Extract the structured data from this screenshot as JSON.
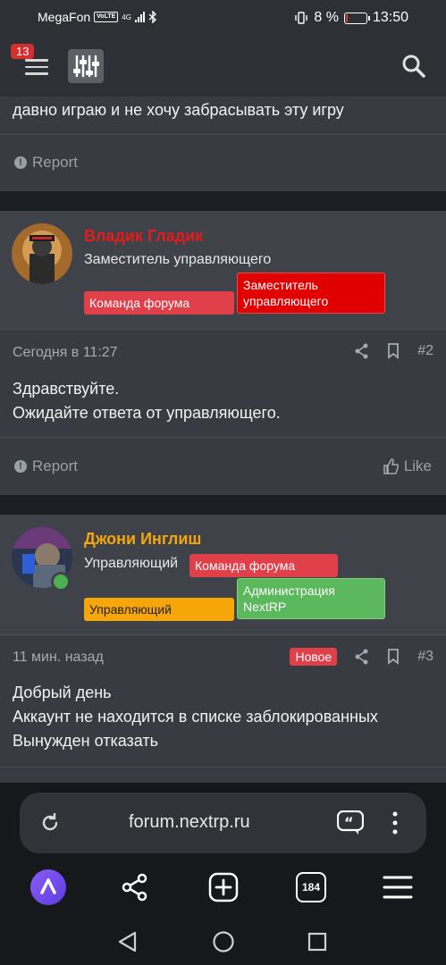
{
  "status_bar": {
    "carrier": "MegaFon",
    "volte": "VoLTE",
    "network": "4G",
    "battery": "8 %",
    "battery_level": 0.08,
    "time": "13:50"
  },
  "header": {
    "notification_count": "13",
    "icons": [
      "menu-icon",
      "settings-sliders-icon",
      "search-icon"
    ]
  },
  "post1": {
    "text": "давно играю и не хочу забрасывать эту игру",
    "report_label": "Report"
  },
  "post2": {
    "author": "Владик Гладик",
    "author_color": "#e51b1b",
    "user_title": "Заместитель управляющего",
    "banners": [
      {
        "label": "Команда форума",
        "color": "#e0404a"
      },
      {
        "label": "Заместитель управляющего",
        "color": "#e00000"
      }
    ],
    "time": "Сегодня в 11:27",
    "number": "#2",
    "lines": [
      "Здравствуйте.",
      "Ожидайте ответа от управляющего."
    ],
    "report_label": "Report",
    "like_label": "Like"
  },
  "post3": {
    "author": "Джони Инглиш",
    "author_color": "#f6a609",
    "user_title": "Управляющий",
    "banners": [
      {
        "label": "Команда форума",
        "color": "#e0404a"
      },
      {
        "label": "Управляющий",
        "color": "#f6a609"
      },
      {
        "label": "Администрация NextRP",
        "color": "#5cb85c"
      }
    ],
    "time": "11 мин. назад",
    "new_label": "Новое",
    "number": "#3",
    "lines": [
      "Добрый день",
      "Аккаунт не находится в списке заблокированных",
      "Вынужден отказать"
    ]
  },
  "browser": {
    "url": "forum.nextrp.ru",
    "tab_count": "184",
    "icons": [
      "reload-icon",
      "quote-icon",
      "more-vert-icon",
      "alice-assistant-icon",
      "share-icon",
      "new-tab-icon",
      "tabs-icon",
      "menu-icon"
    ]
  },
  "system_nav": {
    "icons": [
      "back-icon",
      "home-icon",
      "recents-icon"
    ]
  }
}
